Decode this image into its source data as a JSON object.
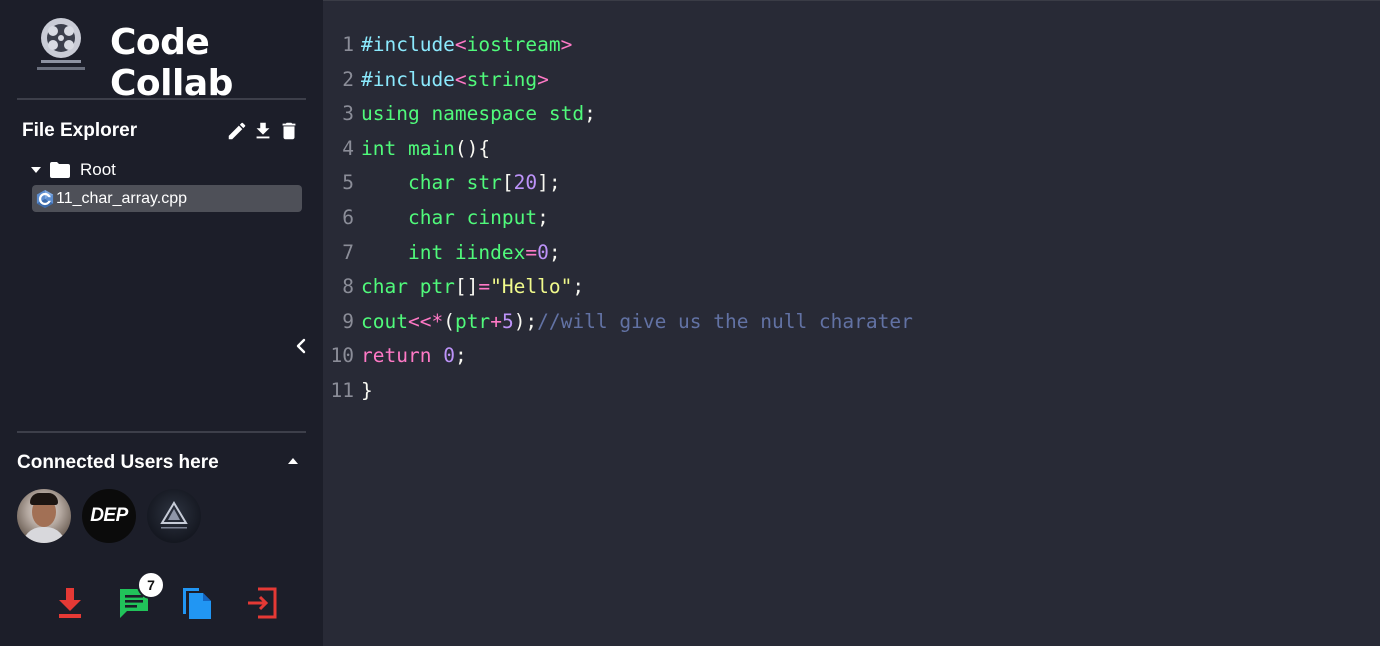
{
  "app": {
    "title": "Code Collab"
  },
  "file_explorer": {
    "title": "File Explorer",
    "tools": [
      "edit-icon",
      "download-icon",
      "trash-icon"
    ],
    "root_label": "Root",
    "files": [
      {
        "name": "11_char_array.cpp",
        "icon": "cpp-icon",
        "selected": true
      }
    ]
  },
  "connected_users": {
    "title": "Connected Users here",
    "users": [
      {
        "kind": "photo"
      },
      {
        "kind": "logo",
        "text": "DEP"
      },
      {
        "kind": "logo",
        "icon": "triangle-logo"
      }
    ]
  },
  "actions": {
    "buttons": [
      "download-icon",
      "chat-icon",
      "copy-icon",
      "exit-icon"
    ],
    "chat_badge": "7"
  },
  "editor": {
    "lines": [
      [
        [
          "pre",
          "#include"
        ],
        [
          "op",
          "<"
        ],
        [
          "kw",
          "iostream"
        ],
        [
          "op",
          ">"
        ]
      ],
      [
        [
          "pre",
          "#include"
        ],
        [
          "op",
          "<"
        ],
        [
          "kw",
          "string"
        ],
        [
          "op",
          ">"
        ]
      ],
      [
        [
          "kw",
          "using namespace std"
        ],
        [
          "punc",
          ";"
        ]
      ],
      [
        [
          "kw",
          "int main"
        ],
        [
          "punc",
          "(){"
        ]
      ],
      [
        [
          "kw",
          "    char str"
        ],
        [
          "punc",
          "["
        ],
        [
          "num",
          "20"
        ],
        [
          "punc",
          "];"
        ]
      ],
      [
        [
          "kw",
          "    char cinput"
        ],
        [
          "punc",
          ";"
        ]
      ],
      [
        [
          "kw",
          "    int iindex"
        ],
        [
          "op",
          "="
        ],
        [
          "num",
          "0"
        ],
        [
          "punc",
          ";"
        ]
      ],
      [
        [
          "kw",
          "char ptr"
        ],
        [
          "punc",
          "[]"
        ],
        [
          "op",
          "="
        ],
        [
          "str",
          "\"Hello\""
        ],
        [
          "punc",
          ";"
        ]
      ],
      [
        [
          "kw",
          "cout"
        ],
        [
          "op",
          "<<*"
        ],
        [
          "punc",
          "("
        ],
        [
          "kw",
          "ptr"
        ],
        [
          "op",
          "+"
        ],
        [
          "num",
          "5"
        ],
        [
          "punc",
          ");"
        ],
        [
          "cm",
          "//will give us the null charater"
        ]
      ],
      [
        [
          "op",
          "return "
        ],
        [
          "num",
          "0"
        ],
        [
          "punc",
          ";"
        ]
      ],
      [
        [
          "punc",
          "}"
        ]
      ]
    ]
  },
  "colors": {
    "sidebar_bg": "#1c1e29",
    "editor_bg": "#282a36",
    "accent_red": "#e53935",
    "accent_green": "#21c35a",
    "accent_blue": "#2196f3"
  }
}
